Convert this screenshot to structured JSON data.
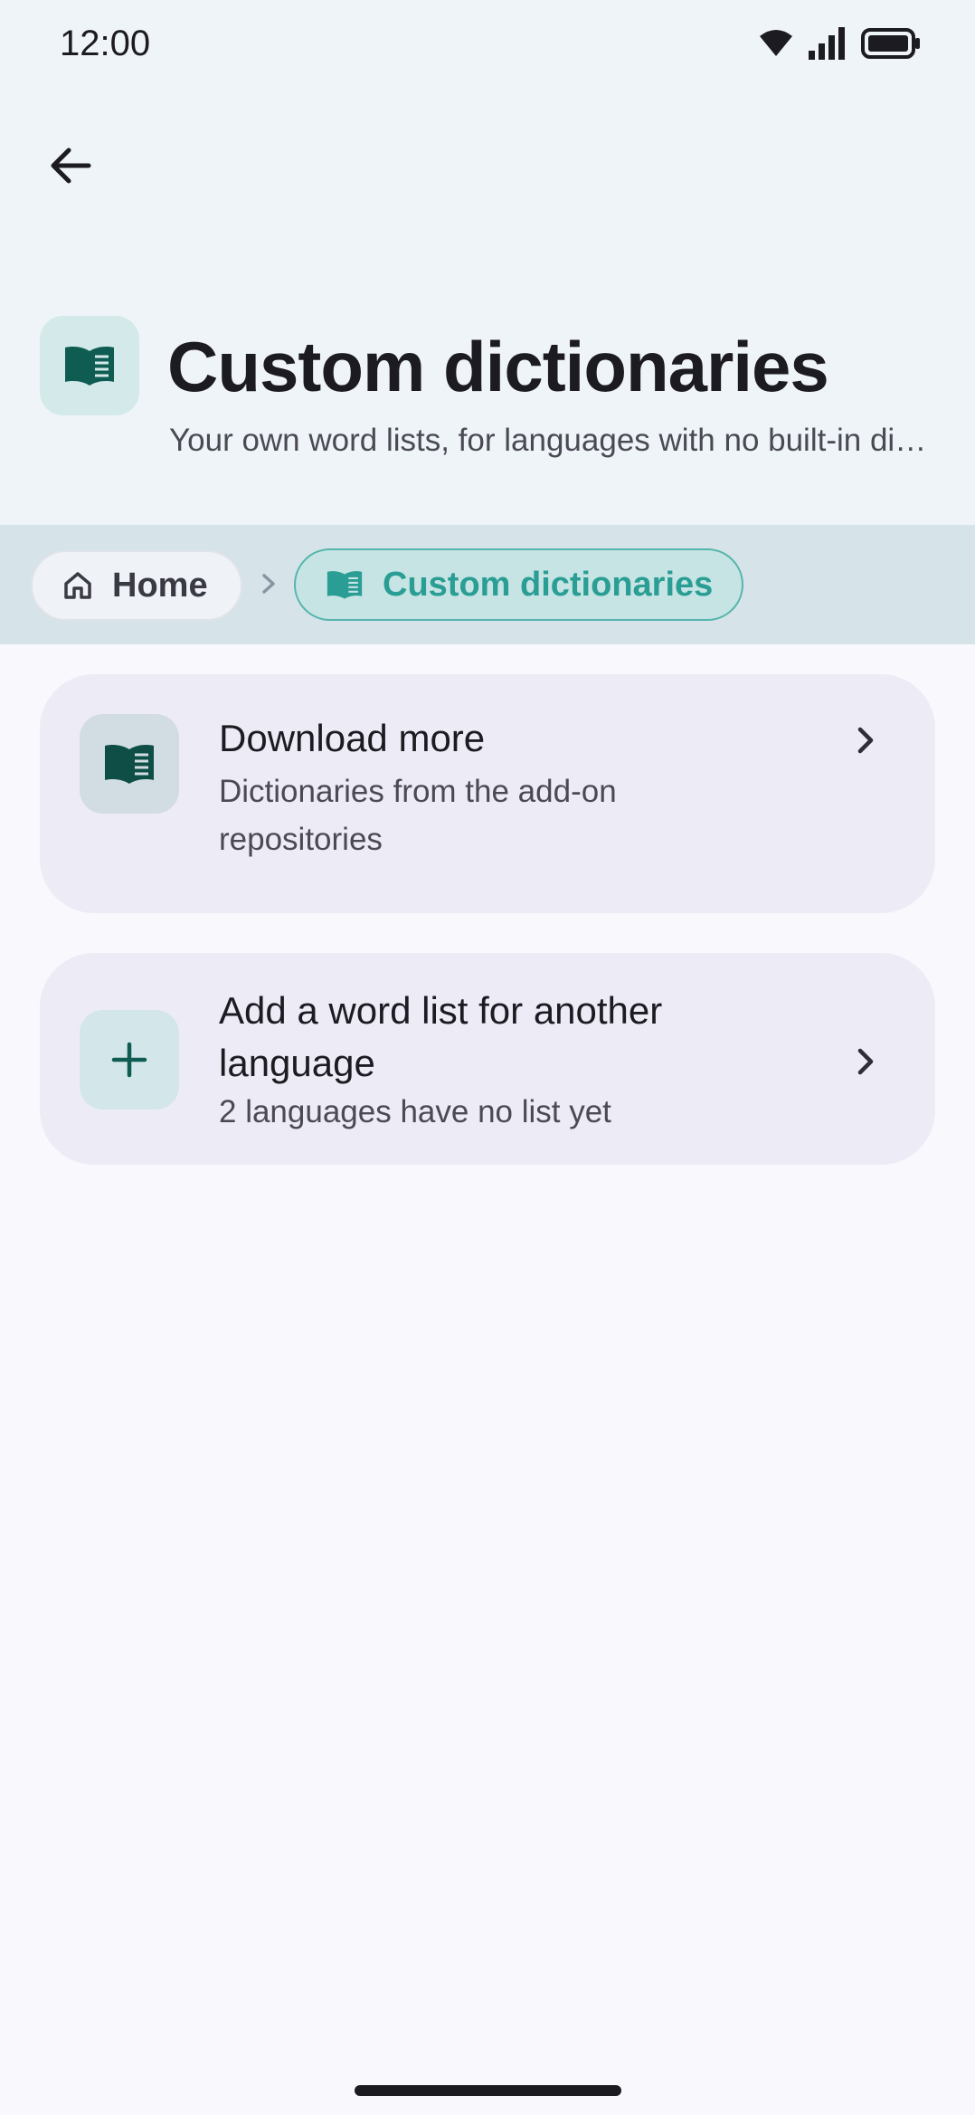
{
  "status_bar": {
    "time": "12:00",
    "icons": [
      "wifi-icon",
      "signal-icon",
      "battery-icon"
    ]
  },
  "header": {
    "back_icon": "arrow-back-icon",
    "icon": "book-icon",
    "title": "Custom dictionaries",
    "subtitle": "Your own word lists, for languages with no built-in dictionary"
  },
  "breadcrumb": {
    "items": [
      {
        "label": "Home",
        "icon": "home-icon"
      },
      {
        "label": "Custom dictionaries",
        "icon": "book-icon"
      }
    ]
  },
  "cards": [
    {
      "title": "Download more",
      "subtitle": "Dictionaries from the add-on repositories",
      "icon": "book-icon"
    },
    {
      "title": "Add a word list for another language",
      "subtitle": "2 languages have no list yet",
      "icon": "plus-icon"
    }
  ],
  "colors": {
    "accent": "#2a9d94",
    "accent_dark": "#0f5c52",
    "top_bg": "#eff4f8",
    "breadcrumb_bg": "#d6e3e8",
    "card_bg": "#edebf5",
    "page_bg": "#f8f8fd"
  }
}
